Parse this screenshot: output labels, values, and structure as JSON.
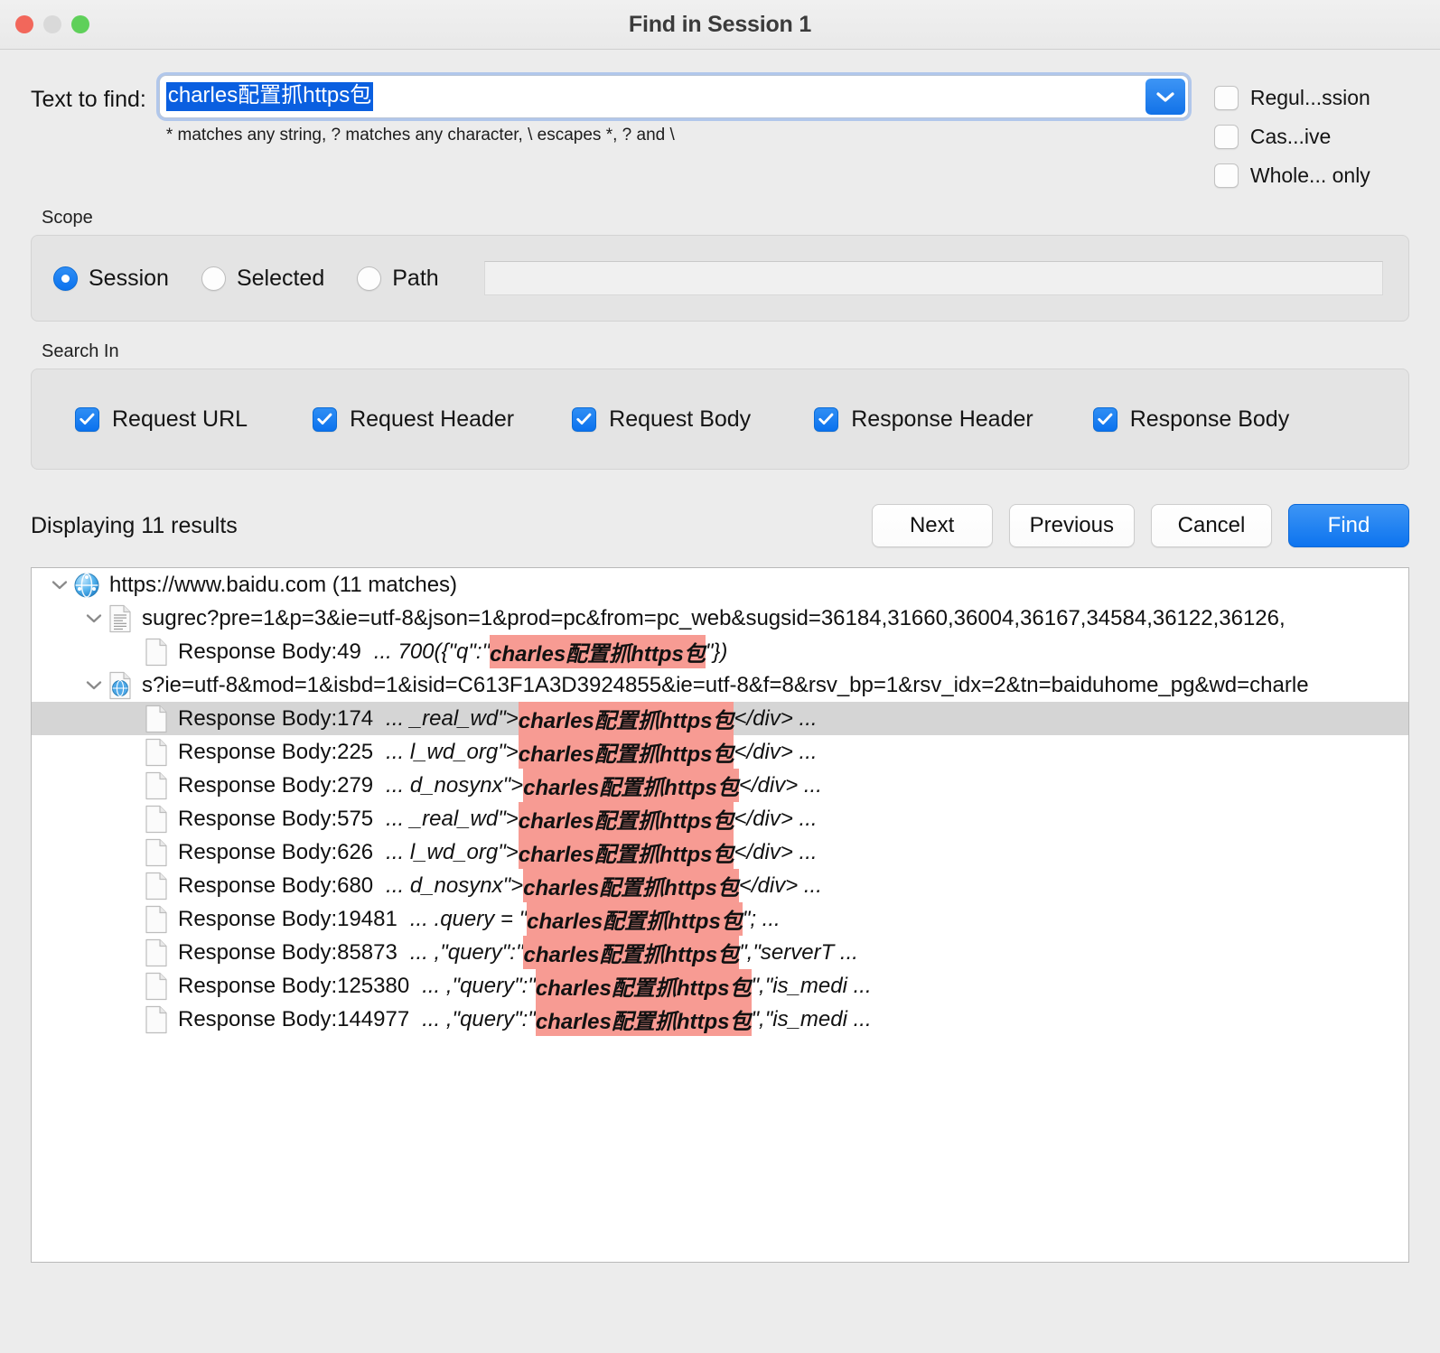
{
  "window": {
    "title": "Find in Session 1",
    "controls": [
      "close",
      "minimize",
      "maximize"
    ]
  },
  "find": {
    "label": "Text to find:",
    "value": "charles配置抓https包",
    "placeholder": "",
    "hint": "* matches any string, ? matches any character, \\ escapes *, ? and \\",
    "dropdown_icon": "chevron-down-icon"
  },
  "options": [
    {
      "label": "Regul...ssion",
      "checked": false,
      "name": "regular-expression"
    },
    {
      "label": "Cas...ive",
      "checked": false,
      "name": "case-sensitive"
    },
    {
      "label": "Whole... only",
      "checked": false,
      "name": "whole-words-only"
    }
  ],
  "scope": {
    "title": "Scope",
    "radios": [
      {
        "label": "Session",
        "selected": true
      },
      {
        "label": "Selected",
        "selected": false
      },
      {
        "label": "Path",
        "selected": false
      }
    ],
    "path_value": "",
    "path_placeholder": ""
  },
  "search_in": {
    "title": "Search In",
    "items": [
      {
        "label": "Request URL",
        "checked": true
      },
      {
        "label": "Request Header",
        "checked": true
      },
      {
        "label": "Request Body",
        "checked": true
      },
      {
        "label": "Response Header",
        "checked": true
      },
      {
        "label": "Response Body",
        "checked": true
      }
    ]
  },
  "results_bar": {
    "count_text": "Displaying 11 results",
    "buttons": [
      {
        "label": "Next",
        "primary": false
      },
      {
        "label": "Previous",
        "primary": false
      },
      {
        "label": "Cancel",
        "primary": false
      },
      {
        "label": "Find",
        "primary": true
      }
    ]
  },
  "tree": {
    "host": {
      "label": "https://www.baidu.com (11 matches)",
      "icon": "globe-icon",
      "expanded": true
    },
    "groups": [
      {
        "icon": "document-lines-icon",
        "expanded": true,
        "label": "sugrec?pre=1&p=3&ie=utf-8&json=1&prod=pc&from=pc_web&sugsid=36184,31660,36004,36167,34584,36122,36126,",
        "matches": [
          {
            "icon": "document-icon",
            "location": "Response Body:49",
            "prefix": "... 700({\"q\":\"",
            "highlight": "charles配置抓https包",
            "suffix": "\"})",
            "selected": false
          }
        ]
      },
      {
        "icon": "document-globe-icon",
        "expanded": true,
        "label": "s?ie=utf-8&mod=1&isbd=1&isid=C613F1A3D3924855&ie=utf-8&f=8&rsv_bp=1&rsv_idx=2&tn=baiduhome_pg&wd=charle",
        "matches": [
          {
            "icon": "document-icon",
            "location": "Response Body:174",
            "prefix": "... _real_wd\">",
            "highlight": "charles配置抓https包",
            "suffix": "</div> ...",
            "selected": true
          },
          {
            "icon": "document-icon",
            "location": "Response Body:225",
            "prefix": "... l_wd_org\">",
            "highlight": "charles配置抓https包",
            "suffix": "</div> ...",
            "selected": false
          },
          {
            "icon": "document-icon",
            "location": "Response Body:279",
            "prefix": "... d_nosynx\">",
            "highlight": "charles配置抓https包",
            "suffix": "</div> ...",
            "selected": false
          },
          {
            "icon": "document-icon",
            "location": "Response Body:575",
            "prefix": "... _real_wd\">",
            "highlight": "charles配置抓https包",
            "suffix": "</div> ...",
            "selected": false
          },
          {
            "icon": "document-icon",
            "location": "Response Body:626",
            "prefix": "... l_wd_org\">",
            "highlight": "charles配置抓https包",
            "suffix": "</div> ...",
            "selected": false
          },
          {
            "icon": "document-icon",
            "location": "Response Body:680",
            "prefix": "... d_nosynx\">",
            "highlight": "charles配置抓https包",
            "suffix": "</div> ...",
            "selected": false
          },
          {
            "icon": "document-icon",
            "location": "Response Body:19481",
            "prefix": "... .query = \"",
            "highlight": "charles配置抓https包",
            "suffix": "\"; ...",
            "selected": false
          },
          {
            "icon": "document-icon",
            "location": "Response Body:85873",
            "prefix": "... ,\"query\":\"",
            "highlight": "charles配置抓https包",
            "suffix": "\",\"serverT ...",
            "selected": false
          },
          {
            "icon": "document-icon",
            "location": "Response Body:125380",
            "prefix": "... ,\"query\":\"",
            "highlight": "charles配置抓https包",
            "suffix": "\",\"is_medi ...",
            "selected": false
          },
          {
            "icon": "document-icon",
            "location": "Response Body:144977",
            "prefix": "... ,\"query\":\"",
            "highlight": "charles配置抓https包",
            "suffix": "\",\"is_medi ...",
            "selected": false
          }
        ]
      }
    ]
  },
  "colors": {
    "accent": "#0d74ef",
    "highlight": "#f79b93",
    "selection": "#0a5fe0",
    "row_selected": "#d5d5d5",
    "window_bg": "#ececec",
    "group_bg": "#e4e4e4"
  }
}
